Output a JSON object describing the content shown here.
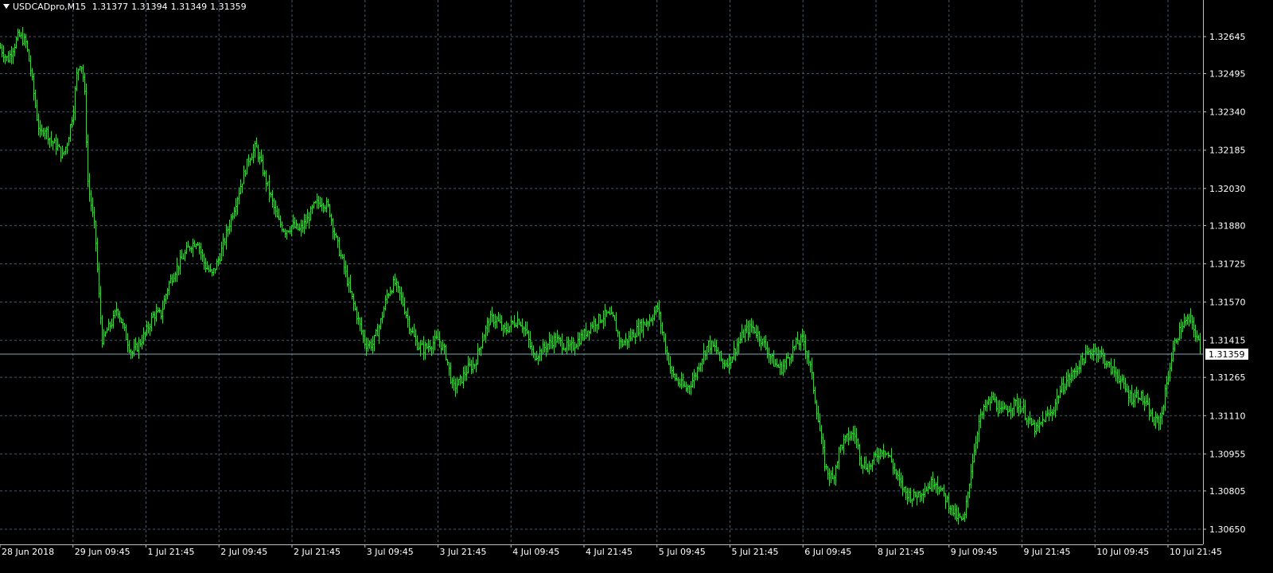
{
  "header": {
    "symbol": "USDCADpro,M15",
    "open": "1.31377",
    "high": "1.31394",
    "low": "1.31349",
    "close": "1.31359"
  },
  "colors": {
    "background": "#000000",
    "bars": "#00ff00",
    "grid": "#44576b",
    "axis": "#c0c0c0",
    "bid_line": "#7fa4b3",
    "text": "#ffffff",
    "price_label_bg": "#ffffff",
    "price_label_text": "#000000"
  },
  "chart_data": {
    "type": "line",
    "style": "OHLC bars",
    "instrument": "USDCADpro",
    "timeframe": "M15",
    "x_tick_labels": [
      "28 Jun 2018",
      "29 Jun 09:45",
      "1 Jul 21:45",
      "2 Jul 09:45",
      "2 Jul 21:45",
      "3 Jul 09:45",
      "3 Jul 21:45",
      "4 Jul 09:45",
      "4 Jul 21:45",
      "5 Jul 09:45",
      "5 Jul 21:45",
      "6 Jul 09:45",
      "8 Jul 21:45",
      "9 Jul 09:45",
      "9 Jul 21:45",
      "10 Jul 09:45",
      "10 Jul 21:45"
    ],
    "y_tick_labels": [
      "1.32645",
      "1.32495",
      "1.32340",
      "1.32185",
      "1.32030",
      "1.31880",
      "1.31725",
      "1.31570",
      "1.31415",
      "1.31265",
      "1.31110",
      "1.30955",
      "1.30805",
      "1.30650"
    ],
    "ylim": [
      1.3062,
      1.3283
    ],
    "current_price": 1.31359,
    "current_price_label": "1.31359",
    "grid": true,
    "grid_style": "dotted",
    "x_tick_positions": [
      0,
      1,
      2,
      3,
      4,
      5,
      6,
      7,
      8,
      9,
      10,
      11,
      12,
      13,
      14,
      15,
      16
    ],
    "price_path": [
      [
        0.0,
        1.326
      ],
      [
        0.1,
        1.3255
      ],
      [
        0.25,
        1.3265
      ],
      [
        0.35,
        1.3262
      ],
      [
        0.42,
        1.325
      ],
      [
        0.5,
        1.3232
      ],
      [
        0.55,
        1.3224
      ],
      [
        0.6,
        1.3228
      ],
      [
        0.7,
        1.3222
      ],
      [
        0.78,
        1.322
      ],
      [
        0.85,
        1.3216
      ],
      [
        0.92,
        1.3222
      ],
      [
        1.0,
        1.3235
      ],
      [
        1.05,
        1.325
      ],
      [
        1.1,
        1.3255
      ],
      [
        1.15,
        1.3245
      ],
      [
        1.2,
        1.3205
      ],
      [
        1.3,
        1.3185
      ],
      [
        1.35,
        1.316
      ],
      [
        1.4,
        1.314
      ],
      [
        1.45,
        1.3145
      ],
      [
        1.55,
        1.315
      ],
      [
        1.6,
        1.3155
      ],
      [
        1.7,
        1.3145
      ],
      [
        1.8,
        1.3136
      ],
      [
        1.9,
        1.314
      ],
      [
        2.0,
        1.3145
      ],
      [
        2.1,
        1.3152
      ],
      [
        2.2,
        1.3152
      ],
      [
        2.3,
        1.3164
      ],
      [
        2.4,
        1.317
      ],
      [
        2.5,
        1.3175
      ],
      [
        2.6,
        1.318
      ],
      [
        2.7,
        1.3182
      ],
      [
        2.8,
        1.3172
      ],
      [
        2.9,
        1.3168
      ],
      [
        3.0,
        1.3175
      ],
      [
        3.1,
        1.3185
      ],
      [
        3.2,
        1.3195
      ],
      [
        3.3,
        1.3205
      ],
      [
        3.4,
        1.3215
      ],
      [
        3.5,
        1.322
      ],
      [
        3.6,
        1.321
      ],
      [
        3.7,
        1.32
      ],
      [
        3.8,
        1.319
      ],
      [
        3.9,
        1.3186
      ],
      [
        4.0,
        1.3188
      ],
      [
        4.1,
        1.3186
      ],
      [
        4.2,
        1.319
      ],
      [
        4.3,
        1.3196
      ],
      [
        4.4,
        1.3198
      ],
      [
        4.5,
        1.3195
      ],
      [
        4.6,
        1.3182
      ],
      [
        4.7,
        1.3172
      ],
      [
        4.8,
        1.316
      ],
      [
        4.9,
        1.315
      ],
      [
        5.0,
        1.314
      ],
      [
        5.1,
        1.314
      ],
      [
        5.2,
        1.3148
      ],
      [
        5.3,
        1.316
      ],
      [
        5.4,
        1.3165
      ],
      [
        5.5,
        1.3158
      ],
      [
        5.6,
        1.3148
      ],
      [
        5.7,
        1.314
      ],
      [
        5.8,
        1.3138
      ],
      [
        5.9,
        1.314
      ],
      [
        6.0,
        1.3142
      ],
      [
        6.1,
        1.3136
      ],
      [
        6.2,
        1.3122
      ],
      [
        6.3,
        1.3125
      ],
      [
        6.4,
        1.313
      ],
      [
        6.5,
        1.3132
      ],
      [
        6.6,
        1.3142
      ],
      [
        6.7,
        1.315
      ],
      [
        6.8,
        1.315
      ],
      [
        6.9,
        1.3145
      ],
      [
        7.0,
        1.3148
      ],
      [
        7.1,
        1.315
      ],
      [
        7.2,
        1.3145
      ],
      [
        7.3,
        1.3135
      ],
      [
        7.4,
        1.3137
      ],
      [
        7.5,
        1.314
      ],
      [
        7.6,
        1.3142
      ],
      [
        7.7,
        1.314
      ],
      [
        7.8,
        1.3138
      ],
      [
        7.9,
        1.3141
      ],
      [
        8.0,
        1.3144
      ],
      [
        8.1,
        1.3148
      ],
      [
        8.2,
        1.315
      ],
      [
        8.3,
        1.3152
      ],
      [
        8.4,
        1.315
      ],
      [
        8.5,
        1.314
      ],
      [
        8.6,
        1.3142
      ],
      [
        8.7,
        1.3145
      ],
      [
        8.8,
        1.3148
      ],
      [
        8.9,
        1.315
      ],
      [
        9.0,
        1.3155
      ],
      [
        9.1,
        1.314
      ],
      [
        9.2,
        1.3128
      ],
      [
        9.3,
        1.3124
      ],
      [
        9.4,
        1.3122
      ],
      [
        9.5,
        1.3126
      ],
      [
        9.6,
        1.3134
      ],
      [
        9.7,
        1.314
      ],
      [
        9.8,
        1.3138
      ],
      [
        9.9,
        1.3132
      ],
      [
        10.0,
        1.3134
      ],
      [
        10.1,
        1.314
      ],
      [
        10.2,
        1.3145
      ],
      [
        10.3,
        1.3147
      ],
      [
        10.4,
        1.3143
      ],
      [
        10.5,
        1.3138
      ],
      [
        10.6,
        1.3132
      ],
      [
        10.7,
        1.313
      ],
      [
        10.8,
        1.3135
      ],
      [
        10.9,
        1.314
      ],
      [
        11.0,
        1.3142
      ],
      [
        11.1,
        1.313
      ],
      [
        11.2,
        1.311
      ],
      [
        11.3,
        1.309
      ],
      [
        11.4,
        1.3085
      ],
      [
        11.5,
        1.3098
      ],
      [
        11.6,
        1.3102
      ],
      [
        11.7,
        1.3104
      ],
      [
        11.8,
        1.3092
      ],
      [
        11.9,
        1.309
      ],
      [
        12.0,
        1.3095
      ],
      [
        12.1,
        1.3098
      ],
      [
        12.2,
        1.3093
      ],
      [
        12.3,
        1.3085
      ],
      [
        12.4,
        1.308
      ],
      [
        12.5,
        1.3078
      ],
      [
        12.6,
        1.308
      ],
      [
        12.7,
        1.3082
      ],
      [
        12.8,
        1.3085
      ],
      [
        12.9,
        1.308
      ],
      [
        13.0,
        1.3075
      ],
      [
        13.1,
        1.307
      ],
      [
        13.2,
        1.3068
      ],
      [
        13.3,
        1.309
      ],
      [
        13.4,
        1.3108
      ],
      [
        13.5,
        1.3115
      ],
      [
        13.6,
        1.3118
      ],
      [
        13.7,
        1.3112
      ],
      [
        13.8,
        1.3114
      ],
      [
        13.9,
        1.3116
      ],
      [
        14.0,
        1.3114
      ],
      [
        14.1,
        1.3108
      ],
      [
        14.2,
        1.3105
      ],
      [
        14.3,
        1.311
      ],
      [
        14.4,
        1.3112
      ],
      [
        14.5,
        1.312
      ],
      [
        14.6,
        1.3125
      ],
      [
        14.7,
        1.3128
      ],
      [
        14.8,
        1.3133
      ],
      [
        14.9,
        1.3136
      ],
      [
        15.0,
        1.3138
      ],
      [
        15.1,
        1.3135
      ],
      [
        15.2,
        1.313
      ],
      [
        15.3,
        1.3128
      ],
      [
        15.4,
        1.3122
      ],
      [
        15.5,
        1.3118
      ],
      [
        15.6,
        1.312
      ],
      [
        15.7,
        1.3115
      ],
      [
        15.8,
        1.3108
      ],
      [
        15.9,
        1.311
      ],
      [
        16.0,
        1.3128
      ],
      [
        16.1,
        1.3142
      ],
      [
        16.2,
        1.3148
      ],
      [
        16.3,
        1.315
      ],
      [
        16.4,
        1.3142
      ],
      [
        16.45,
        1.3136
      ]
    ]
  }
}
